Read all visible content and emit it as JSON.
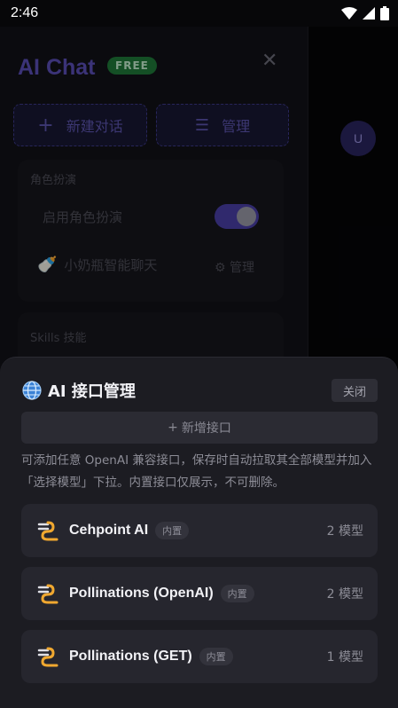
{
  "status": {
    "time": "2:46"
  },
  "drawer": {
    "title": "AI Chat",
    "badge": "FREE",
    "new_chat_label": "新建对话",
    "manage_label": "管理",
    "role_section_label": "角色扮演",
    "role_toggle_label": "启用角色扮演",
    "role_enabled": true,
    "role_name": "小奶瓶智能聊天",
    "role_manage_label": "管理",
    "skills_section_label": "Skills 技能"
  },
  "background": {
    "avatar_letter": "U"
  },
  "sheet": {
    "title": "AI 接口管理",
    "close_label": "关闭",
    "add_label": "新增接口",
    "description": "可添加任意 OpenAI 兼容接口，保存时自动拉取其全部模型并加入「选择模型」下拉。内置接口仅展示，不可删除。",
    "apis": [
      {
        "name": "Cehpoint AI",
        "tag": "内置",
        "count": "2 模型"
      },
      {
        "name": "Pollinations (OpenAI)",
        "tag": "内置",
        "count": "2 模型"
      },
      {
        "name": "Pollinations (GET)",
        "tag": "内置",
        "count": "1 模型"
      }
    ]
  },
  "colors": {
    "accent": "#5b4fb8",
    "badge_green": "#1f7a3a",
    "sheet_bg": "#1c1c22"
  }
}
